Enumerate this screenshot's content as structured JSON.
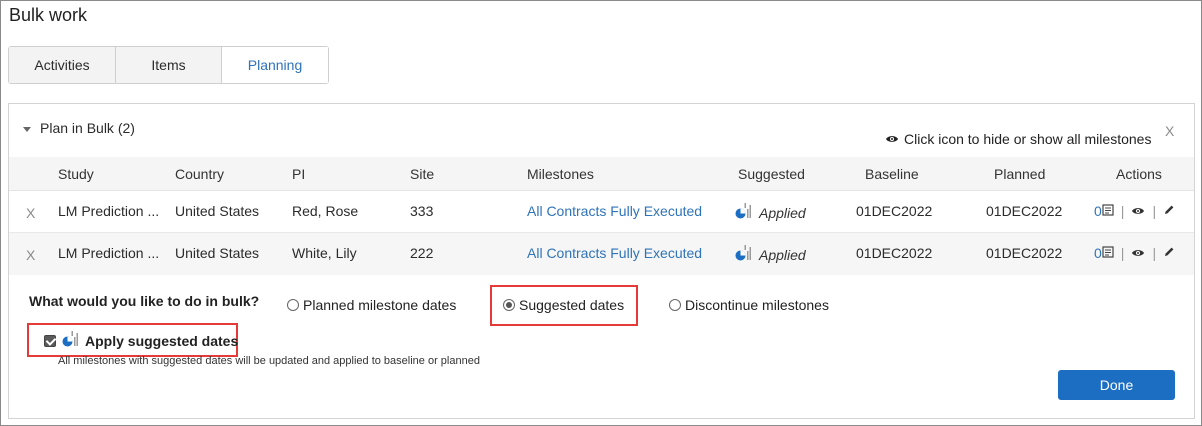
{
  "page": {
    "title": "Bulk work"
  },
  "tabs": [
    {
      "label": "Activities"
    },
    {
      "label": "Items"
    },
    {
      "label": "Planning"
    }
  ],
  "panel": {
    "title": "Plan in Bulk (2)",
    "hint": "Click icon to hide or show all milestones",
    "close": "X"
  },
  "table": {
    "columns": [
      "Study",
      "Country",
      "PI",
      "Site",
      "Milestones",
      "Suggested",
      "Baseline",
      "Planned",
      "Actions"
    ],
    "rows": [
      {
        "remove": "X",
        "study": "LM Prediction ...",
        "country": "United States",
        "pi": "Red, Rose",
        "site": "333",
        "milestone": "All Contracts Fully Executed",
        "suggested": "Applied",
        "baseline": "01DEC2022",
        "planned": "01DEC2022",
        "count": "0"
      },
      {
        "remove": "X",
        "study": "LM Prediction ...",
        "country": "United States",
        "pi": "White, Lily",
        "site": "222",
        "milestone": "All Contracts Fully Executed",
        "suggested": "Applied",
        "baseline": "01DEC2022",
        "planned": "01DEC2022",
        "count": "0"
      }
    ]
  },
  "bulk": {
    "question": "What would you like to do in bulk?",
    "options": [
      {
        "label": "Planned milestone dates",
        "selected": false
      },
      {
        "label": "Suggested dates",
        "selected": true
      },
      {
        "label": "Discontinue milestones",
        "selected": false
      }
    ],
    "apply_label": "Apply suggested dates",
    "apply_checked": true,
    "apply_note": "All milestones with suggested dates will be updated and applied to baseline or planned"
  },
  "buttons": {
    "done": "Done"
  },
  "colors": {
    "link": "#2f73b8",
    "primary": "#1b6ec2",
    "highlight": "#e53a3a"
  },
  "icons": [
    "caret-down-icon",
    "eye-icon",
    "close-icon",
    "suggested-dates-icon",
    "notes-icon",
    "pencil-icon"
  ]
}
